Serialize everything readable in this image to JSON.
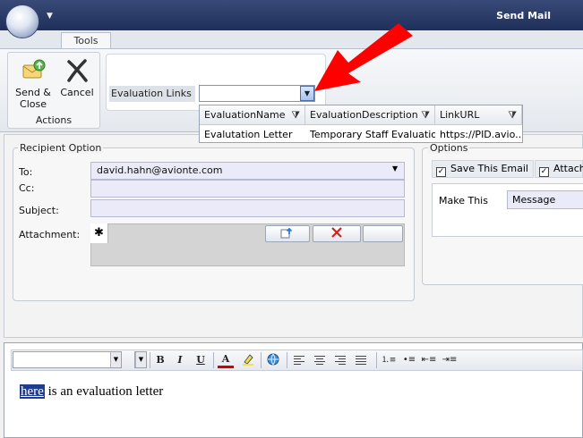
{
  "window": {
    "title": "Send Mail"
  },
  "ribbon": {
    "tab": "Tools",
    "actions_group_label": "Actions",
    "send_close_label": "Send & Close",
    "cancel_label": "Cancel",
    "evaluation_links_label": "Evaluation Links",
    "evaluation_links_value": ""
  },
  "dropdown": {
    "columns": [
      "EvaluationName",
      "EvaluationDescription",
      "LinkURL"
    ],
    "rows": [
      [
        "Evalutation Letter",
        "Temporary Staff Evaluatio...",
        "https://PID.avio..."
      ]
    ]
  },
  "recipient": {
    "group_label": "Recipient Option",
    "to_label": "To:",
    "to_value": "david.hahn@avionte.com",
    "cc_label": "Cc:",
    "cc_value": "",
    "subject_label": "Subject:",
    "subject_value": "",
    "attachment_label": "Attachment:",
    "attachment_new_row": "✱"
  },
  "options": {
    "group_label": "Options",
    "save_email_label": "Save This Email",
    "save_email_checked": true,
    "attach_label": "Attach",
    "attach_checked": true,
    "make_this_label": "Make This",
    "make_this_value": "Message"
  },
  "editor": {
    "link_text": "here",
    "body_text": " is an evaluation letter",
    "toolbar": {
      "bold": "B",
      "italic": "I",
      "underline": "U",
      "font_color": "A"
    }
  },
  "colors": {
    "title_bar": "#1f2f5a",
    "accent_arrow": "#ff0000",
    "field_bg": "#eaeaf8"
  }
}
